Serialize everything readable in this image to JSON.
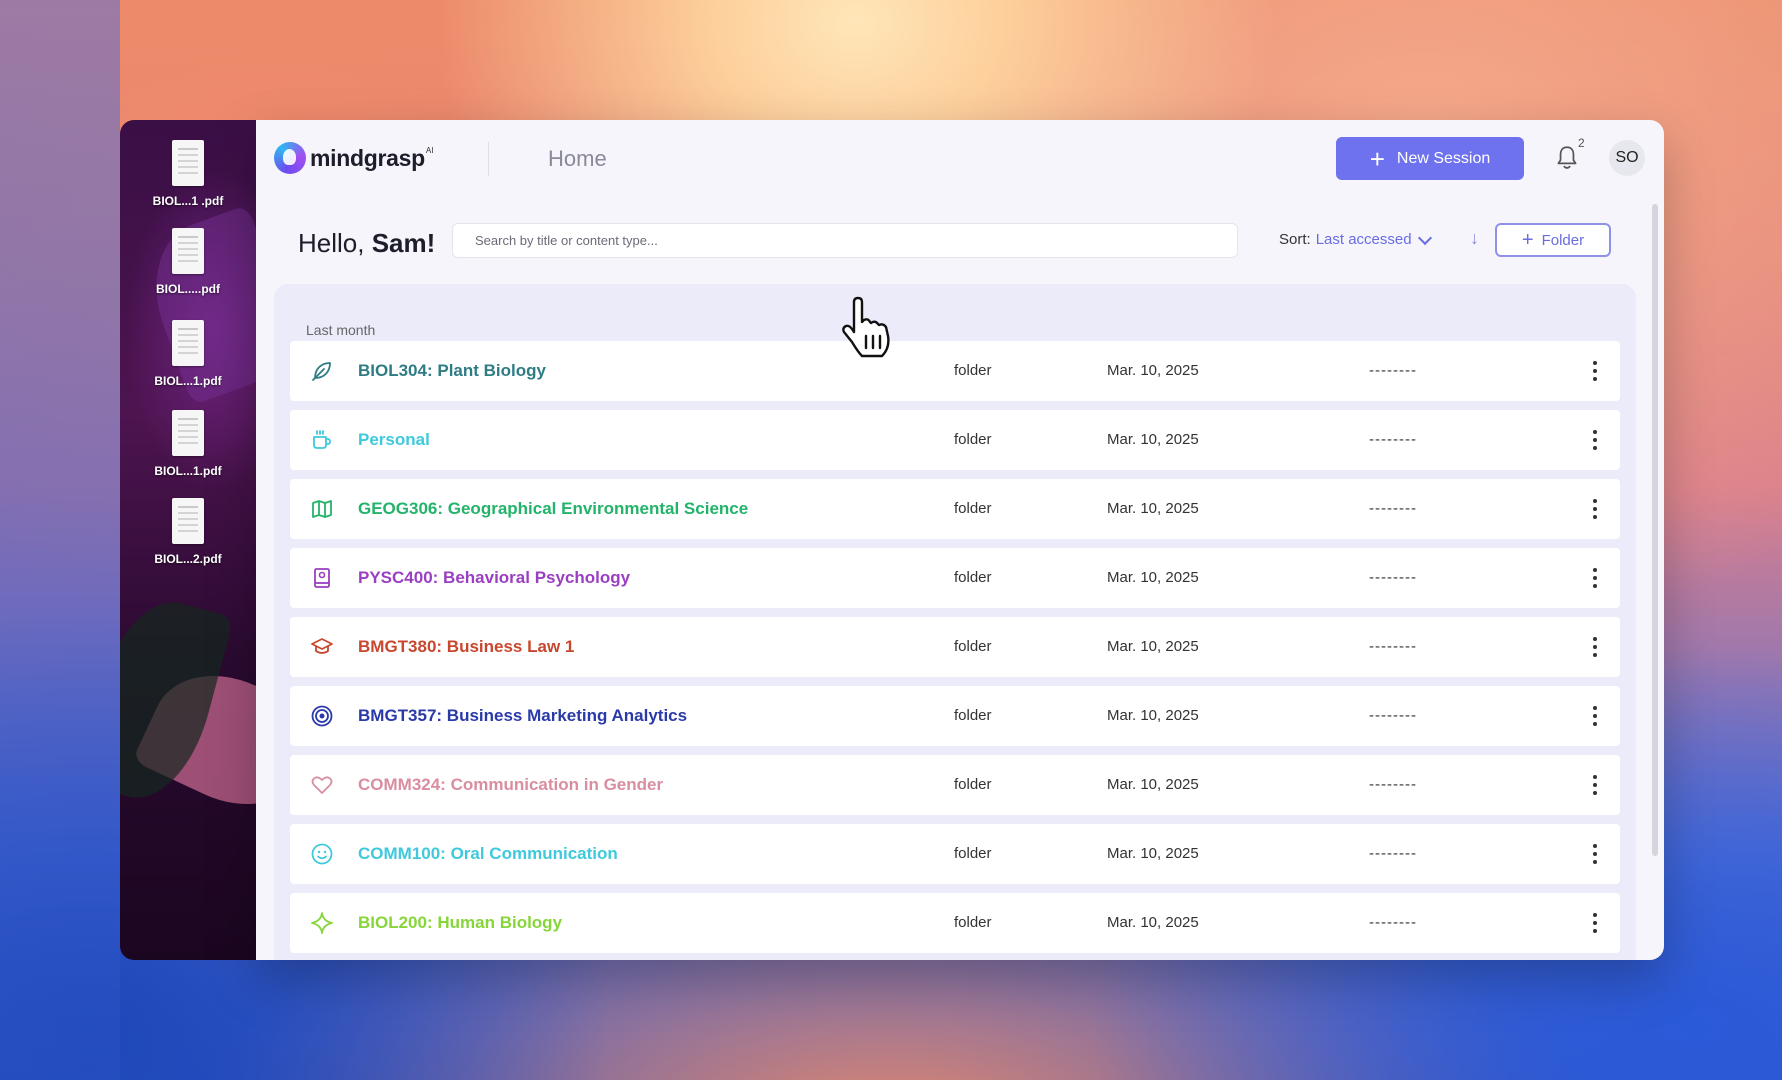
{
  "desktop": {
    "files": [
      {
        "name": "BIOL...1 .pdf"
      },
      {
        "name": "BIOL.....pdf"
      },
      {
        "name": "BIOL...1.pdf"
      },
      {
        "name": "BIOL...1.pdf"
      },
      {
        "name": "BIOL...2.pdf"
      }
    ]
  },
  "header": {
    "logo_text": "mindgrasp",
    "logo_superscript": "AI",
    "page_title": "Home",
    "new_session_label": "New Session",
    "notification_count": "2",
    "avatar_initials": "SO"
  },
  "toolbar": {
    "greeting_prefix": "Hello, ",
    "greeting_name": "Sam!",
    "search_placeholder": "Search by title or content type...",
    "sort_label": "Sort:",
    "sort_value": "Last accessed",
    "sort_direction_icon": "arrow-down-icon",
    "folder_button_label": "Folder"
  },
  "list": {
    "section_label": "Last month",
    "rows": [
      {
        "title": "BIOL304: Plant Biology",
        "type": "folder",
        "date": "Mar. 10, 2025",
        "extra": "--------",
        "icon": "leaf-icon",
        "color": "#2e7c84"
      },
      {
        "title": "Personal",
        "type": "folder",
        "date": "Mar. 10, 2025",
        "extra": "--------",
        "icon": "coffee-cup-icon",
        "color": "#3ec9dc"
      },
      {
        "title": "GEOG306: Geographical Environmental Science",
        "type": "folder",
        "date": "Mar. 10, 2025",
        "extra": "--------",
        "icon": "map-icon",
        "color": "#23b36a"
      },
      {
        "title": "PYSC400: Behavioral Psychology",
        "type": "folder",
        "date": "Mar. 10, 2025",
        "extra": "--------",
        "icon": "book-icon",
        "color": "#9b3fc2"
      },
      {
        "title": "BMGT380: Business Law 1",
        "type": "folder",
        "date": "Mar. 10, 2025",
        "extra": "--------",
        "icon": "graduation-cap-icon",
        "color": "#c8472e"
      },
      {
        "title": "BMGT357: Business Marketing Analytics",
        "type": "folder",
        "date": "Mar. 10, 2025",
        "extra": "--------",
        "icon": "target-icon",
        "color": "#2a3aa8"
      },
      {
        "title": "COMM324: Communication in Gender",
        "type": "folder",
        "date": "Mar. 10, 2025",
        "extra": "--------",
        "icon": "heart-icon",
        "color": "#d98ea0"
      },
      {
        "title": "COMM100: Oral Communication",
        "type": "folder",
        "date": "Mar. 10, 2025",
        "extra": "--------",
        "icon": "smiley-icon",
        "color": "#3ec9dc"
      },
      {
        "title": "BIOL200: Human Biology",
        "type": "folder",
        "date": "Mar. 10, 2025",
        "extra": "--------",
        "icon": "sparkle-icon",
        "color": "#86d63a"
      }
    ]
  },
  "colors": {
    "accent": "#6e72ef",
    "panel_background": "#ebebfa"
  }
}
